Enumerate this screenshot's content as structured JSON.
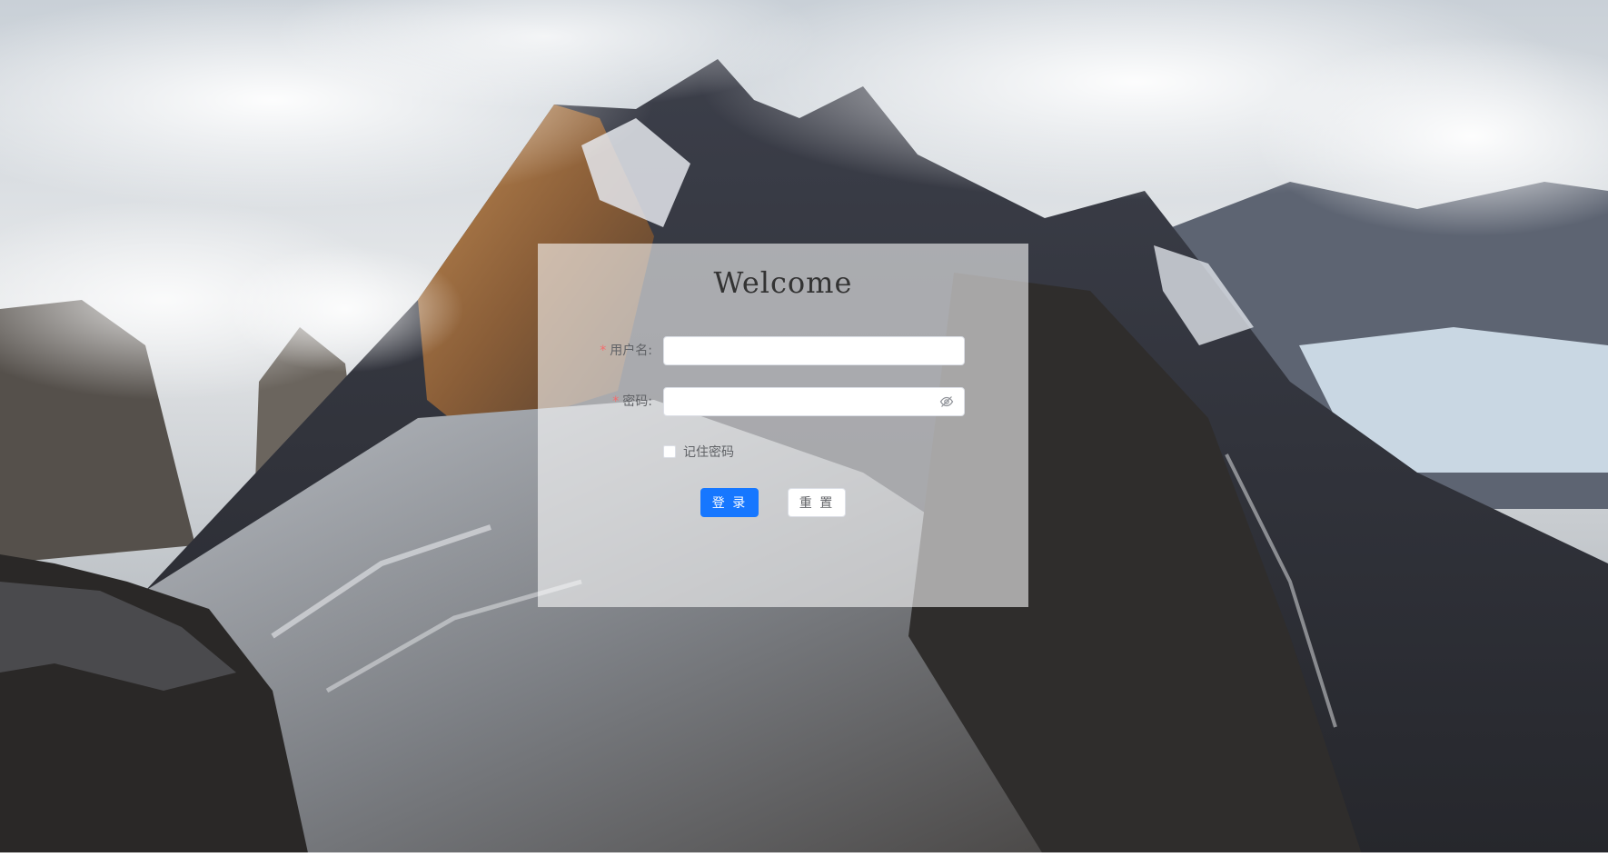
{
  "background": {
    "description_icon": "mountain-landscape-image"
  },
  "card": {
    "title": "Welcome"
  },
  "form": {
    "username": {
      "required_mark": "*",
      "label": "用户名:",
      "value": "",
      "placeholder": ""
    },
    "password": {
      "required_mark": "*",
      "label": "密码:",
      "value": "",
      "placeholder": "",
      "toggle_icon": "eye-hidden-icon"
    },
    "remember": {
      "label": "记住密码",
      "checked": false
    },
    "buttons": {
      "login_label": "登 录",
      "reset_label": "重 置"
    }
  },
  "colors": {
    "primary": "#1677ff",
    "required": "#f56c6c",
    "label": "#606266",
    "title": "#333333"
  }
}
